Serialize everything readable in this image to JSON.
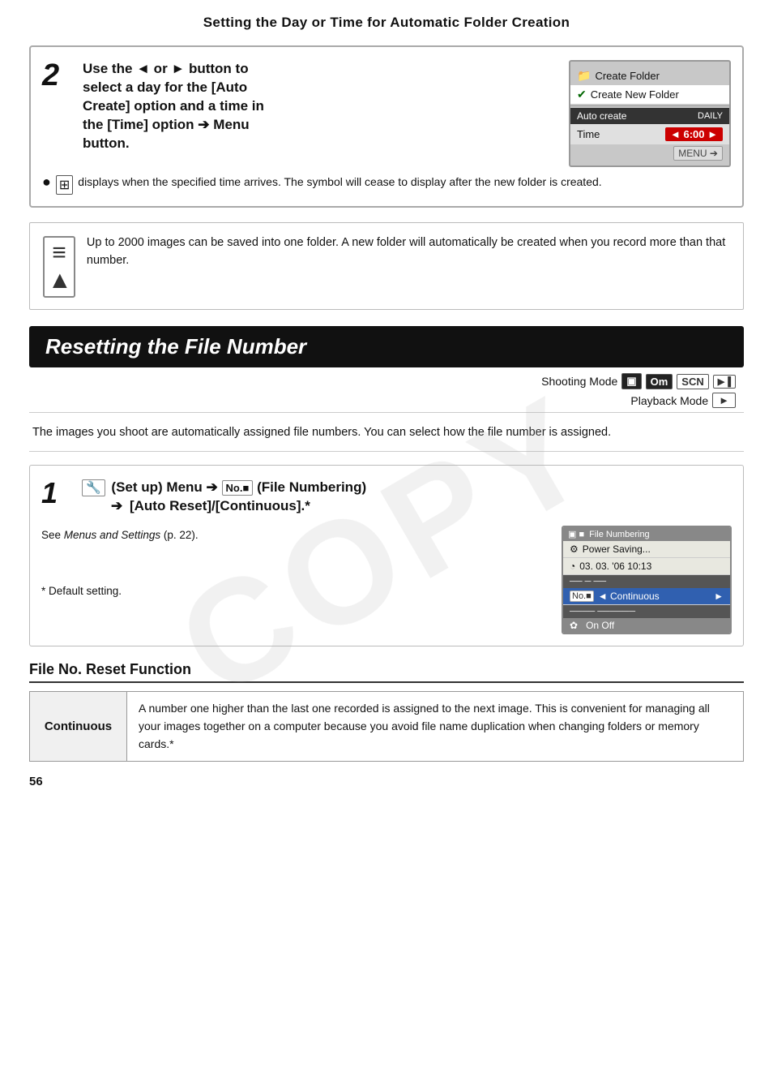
{
  "page": {
    "top_heading": "Setting the Day or Time for Automatic Folder Creation",
    "page_number": "56"
  },
  "section2": {
    "step_number": "2",
    "title_line1": "Use the ◄ or ► button to",
    "title_line2": "select a day for the [Auto",
    "title_line3": "Create] option and a time in",
    "title_line4": "the [Time] option",
    "title_arrow": "➔",
    "title_line5": "Menu",
    "title_line6": "button.",
    "camera": {
      "item1": "Create Folder",
      "item2": "Create New Folder",
      "dark_label": "Auto create",
      "dark_value": "DAILY",
      "time_label": "Time",
      "time_value": "◄ 6:00 ►",
      "menu_btn": "MENU ➔"
    },
    "bullet_text": " displays when the specified time arrives. The symbol will cease to display after the new folder is created."
  },
  "note": {
    "icon_text": "≡▲",
    "text": "Up to 2000 images can be saved into one folder. A new folder will automatically be created when you record more than that number."
  },
  "section_resetting": {
    "heading": "Resetting the File Number",
    "shooting_label": "Shooting Mode",
    "shooting_icons": [
      "▣",
      "Om",
      "SCN",
      "▶▐"
    ],
    "playback_label": "Playback Mode",
    "playback_icon": "►",
    "intro": "The images you shoot are automatically assigned file numbers. You can select how the file number is assigned."
  },
  "step1": {
    "step_number": "1",
    "title_part1": "🔧 (Set up) Menu",
    "title_arrow1": "➔",
    "title_part2": "No.■ (File Numbering)",
    "title_arrow2": "➔",
    "title_part3": "[Auto Reset]/[Continuous].*",
    "see_text": "See Menus and Settings (p. 22).",
    "default_label": "*  Default setting.",
    "camera2": {
      "title": "File Numbering",
      "row1_icon": "▣",
      "row1_label": "Power Saving...",
      "row2_icon": "◔",
      "row2_label": "03. 03. '06 10:13",
      "row3_label": "── ─ ──",
      "row4_icon": "No.■",
      "row4_label": "◄ Continuous",
      "row4_arrow": "►",
      "row5_label": "──── ──────",
      "row6_icon": "✿",
      "row6_label": "On  Off"
    }
  },
  "file_reset": {
    "heading": "File No. Reset Function",
    "continuous_label": "Continuous",
    "continuous_text": "A number one higher than the last one recorded is assigned to the next image. This is convenient for managing all your images together on a computer because you avoid file name duplication when changing folders or memory cards.*"
  }
}
